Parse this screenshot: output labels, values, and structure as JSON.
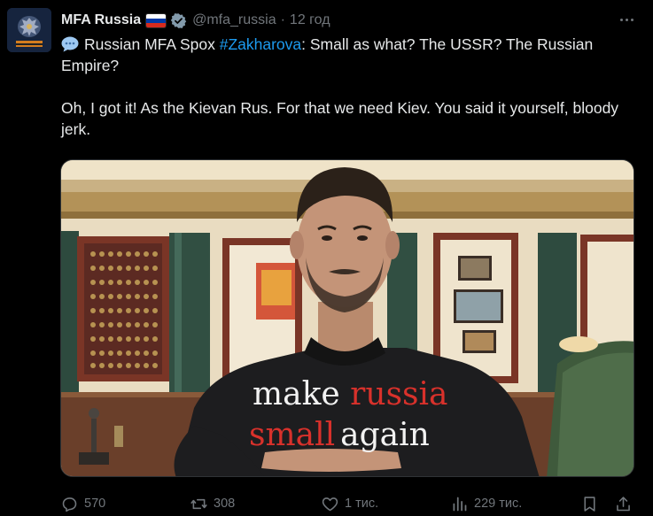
{
  "account": {
    "name": "MFA Russia",
    "handle": "@mfa_russia",
    "separator": "·",
    "time": "12 год",
    "flag_colors": [
      "#ffffff",
      "#0039a6",
      "#d52b1e"
    ],
    "verified_color": "#829aab"
  },
  "tweet": {
    "prefix": "Russian MFA Spox ",
    "hashtag": "#Zakharova",
    "line1_rest": ": Small as what? The USSR? The Russian Empire?",
    "line2": "Oh, I got it! As the Kievan Rus. For that we need Kiev. You said it yourself, bloody jerk."
  },
  "media": {
    "shirt_line1_a": "make ",
    "shirt_line1_b": "russia",
    "shirt_line2_a": "small",
    "shirt_line2_b": "again"
  },
  "actions": {
    "replies": "570",
    "reposts": "308",
    "likes": "1 тис.",
    "views": "229 тис.",
    "icons": [
      "reply-icon",
      "repost-icon",
      "like-icon",
      "views-icon",
      "bookmark-icon",
      "share-icon"
    ]
  },
  "colors": {
    "accent": "#1d9bf0",
    "muted": "#71767b",
    "background": "#000000"
  }
}
